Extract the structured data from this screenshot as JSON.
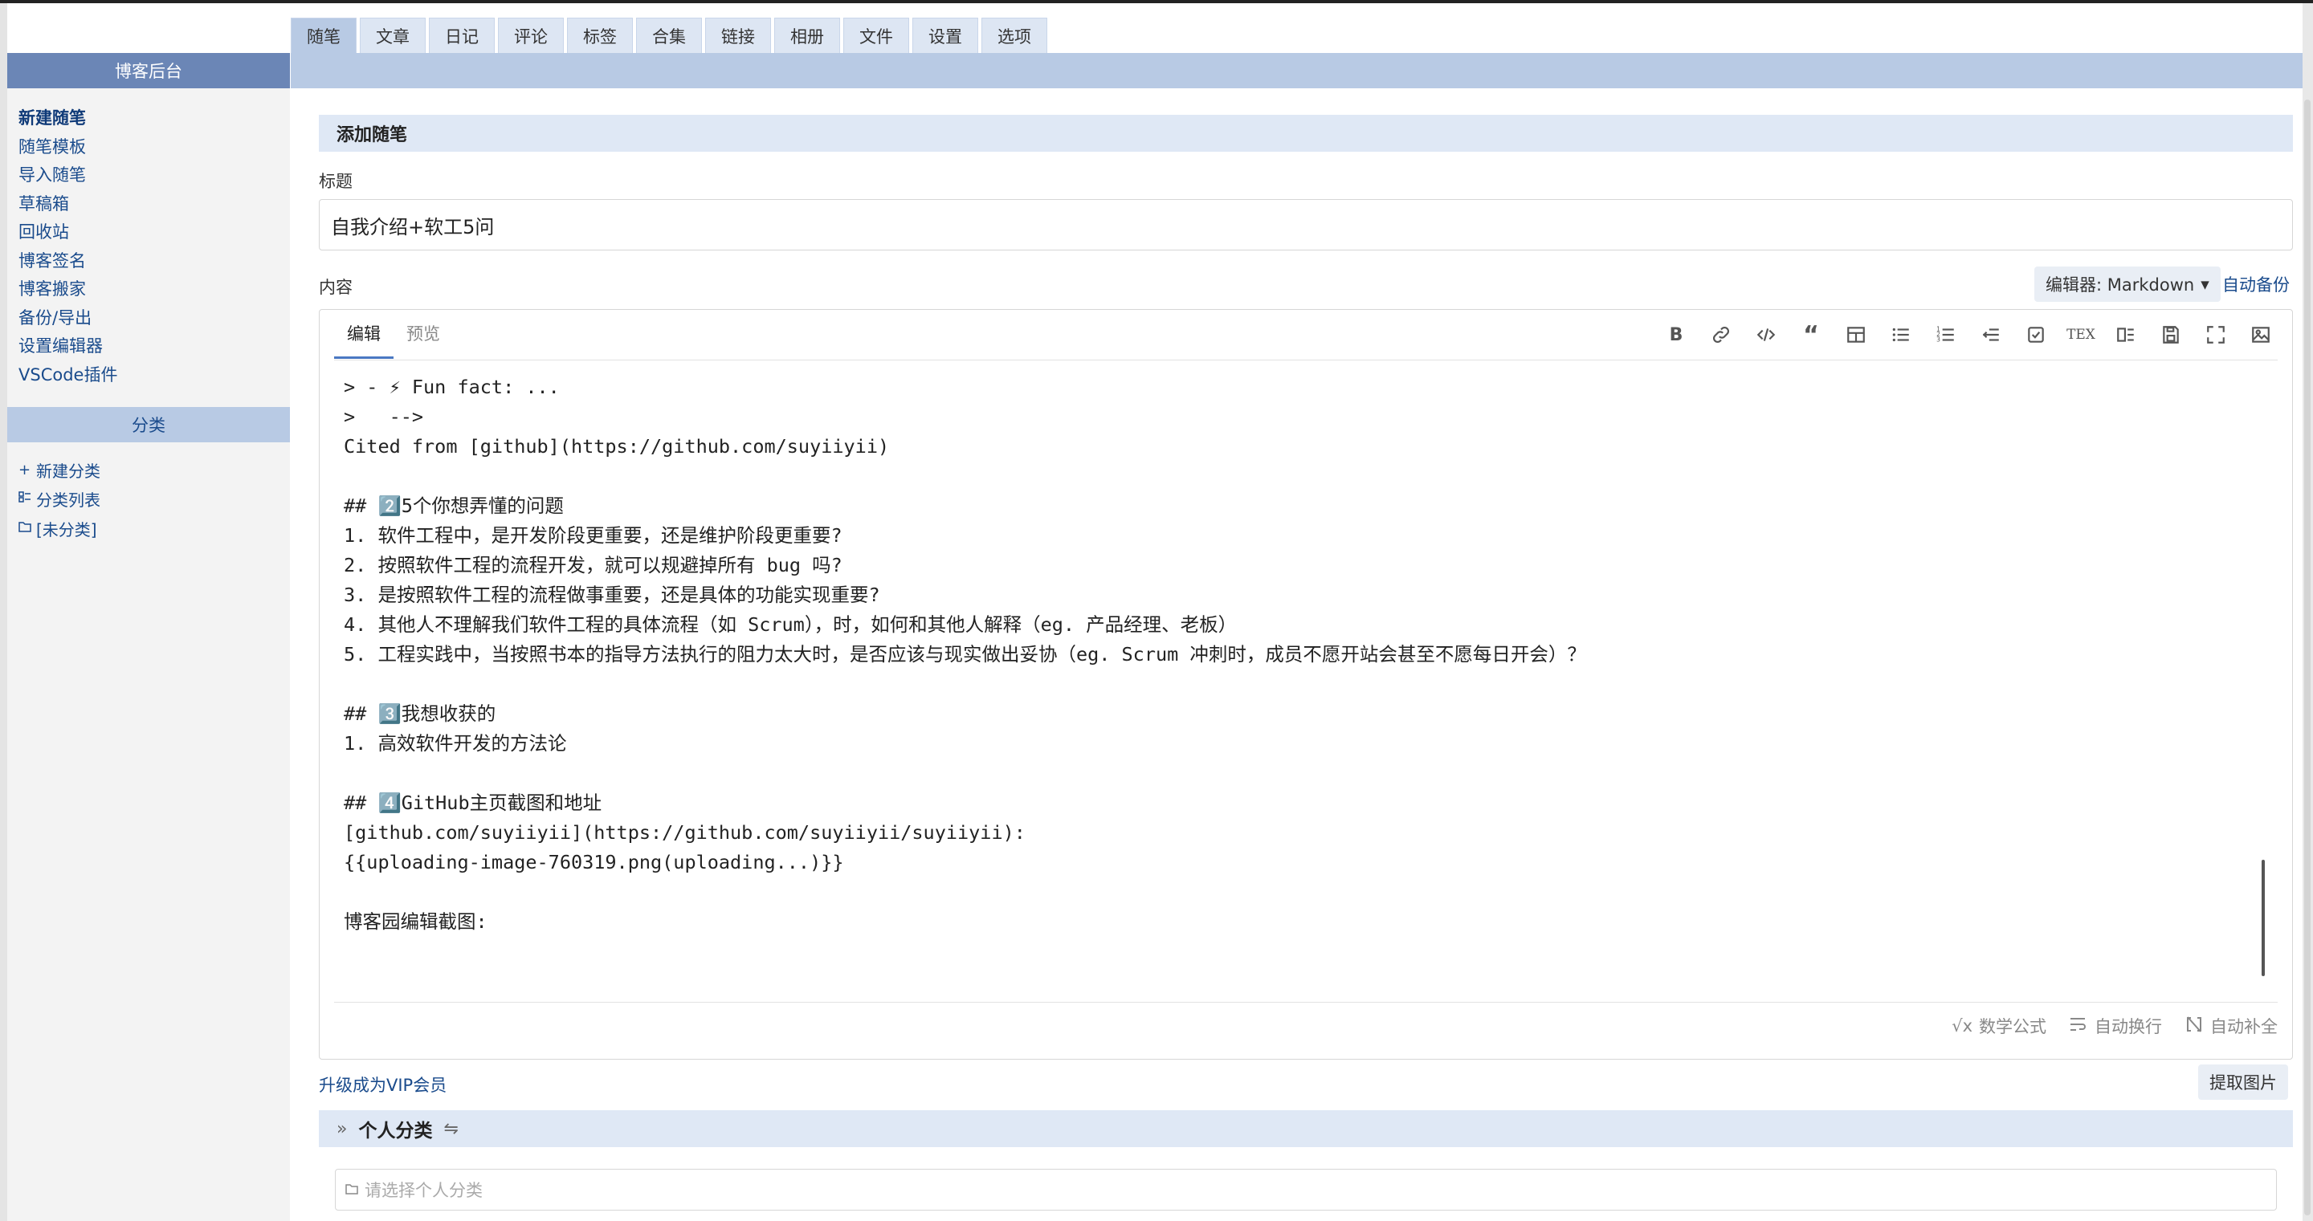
{
  "sidebar": {
    "header": "博客后台",
    "links": [
      "新建随笔",
      "随笔模板",
      "导入随笔",
      "草稿箱",
      "回收站",
      "博客签名",
      "博客搬家",
      "备份/导出",
      "设置编辑器",
      "VSCode插件"
    ],
    "category_header": "分类",
    "category_links": [
      {
        "icon": "plus-icon",
        "label": "新建分类"
      },
      {
        "icon": "list-icon",
        "label": "分类列表"
      },
      {
        "icon": "folder-icon",
        "label": "[未分类]"
      }
    ]
  },
  "tabs": [
    "随笔",
    "文章",
    "日记",
    "评论",
    "标签",
    "合集",
    "链接",
    "相册",
    "文件",
    "设置",
    "选项"
  ],
  "form": {
    "section_title": "添加随笔",
    "title_label": "标题",
    "title_value": "自我介绍+软工5问",
    "content_label": "内容",
    "editor_select": "编辑器: Markdown",
    "auto_backup": "自动备份"
  },
  "editor": {
    "tabs": [
      "编辑",
      "预览"
    ],
    "lines": [
      "> - ⚡ Fun fact: ...",
      ">   -->",
      "Cited from [github](https://github.com/suyiiyii)",
      "",
      "## 2️⃣5个你想弄懂的问题",
      "1. 软件工程中，是开发阶段更重要，还是维护阶段更重要?",
      "2. 按照软件工程的流程开发，就可以规避掉所有 bug 吗?",
      "3. 是按照软件工程的流程做事重要，还是具体的功能实现重要?",
      "4. 其他人不理解我们软件工程的具体流程（如 Scrum），时，如何和其他人解释（eg. 产品经理、老板）",
      "5. 工程实践中，当按照书本的指导方法执行的阻力太大时，是否应该与现实做出妥协（eg. Scrum 冲刺时，成员不愿开站会甚至不愿每日开会）？",
      "",
      "## 3️⃣我想收获的",
      "1. 高效软件开发的方法论",
      "",
      "## 4️⃣GitHub主页截图和地址",
      "[github.com/suyiiyii](https://github.com/suyiiyii/suyiiyii):",
      "{{uploading-image-760319.png(uploading...)}}",
      "",
      "博客园编辑截图:"
    ],
    "status": {
      "math": "数学公式",
      "wrap": "自动换行",
      "autocomplete": "自动补全"
    }
  },
  "footer": {
    "vip": "升级成为VIP会员",
    "extract": "提取图片",
    "personal_category": "个人分类",
    "category_placeholder": "请选择个人分类"
  },
  "colors": {
    "sidebar_header": "#6b86b6",
    "tab_bar": "#b8cae4",
    "section_bar": "#dfe8f5",
    "link": "#1a4b8c"
  }
}
